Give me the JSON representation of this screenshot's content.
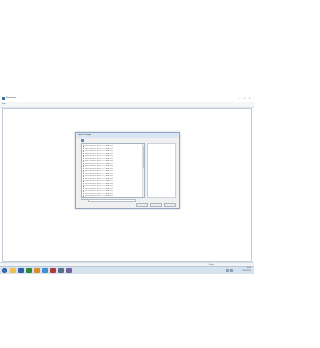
{
  "app": {
    "title": "Mongoose",
    "window_controls": [
      "–",
      "□",
      "×"
    ],
    "menu": [
      "File"
    ]
  },
  "dialog": {
    "title": "Open Package",
    "close_glyph": "×",
    "up_icon": "folder-up-icon",
    "files": [
      "0001 UN-2013 Ver13 - 4.7 - Audi VW",
      "0002 UN-2013 Ver13 - 4.7 - Audi VW",
      "0003 UN-2013 Ver13 - 4.7 - Audi VW",
      "0004 UN-2013 Ver13 - 4.7 - Audi VW",
      "0005 UN-2013 Ver13 - 4.7 - Audi VW",
      "0006 UN-2013 Ver13 - 4.7 - Audi VW",
      "0007 UN-2013 Ver13 - 4.7 - Audi VW",
      "0008 UN-2013 Ver13 - 4.7 - Audi VW",
      "0009 UN-2013 Ver13 - 4.7 - Audi VW",
      "0010 UN-2013 Ver13 - 4.7 - Audi VW",
      "0011 UN-2013 Ver13 - 4.7 - Audi VW",
      "0012 UN-2013 Ver13 - 4.7 - Audi VW",
      "0013 UN-2013 Ver13 - 4.7 - Audi VW",
      "0014 UN-2013 Ver13 - 4.7 - Audi VW",
      "0015 UN-2013 Ver13 - 4.7 - Audi VW",
      "0016 UN-2013 Ver13 - 4.7 - Audi VW",
      "0017 UN-2013 Ver13 - 4.7 - Audi VW",
      "0018 UN-2013 Ver13 - 4.7 - Audi VW",
      "0019 UN-2013 Ver13 - 4.7 - Audi VW",
      "0020 UN-2013 Ver13 - 4.7 - Audi VW",
      "0021 UN-2013 Ver13 - 4.7 - Audi VW"
    ],
    "field_label": "Selection:",
    "field_value": "",
    "buttons": [
      "Cancel",
      "Open",
      "Back"
    ]
  },
  "status": {
    "right_text": "Ready"
  },
  "taskbar": {
    "apps": [
      {
        "name": "explorer-icon",
        "color": "#f0c04a"
      },
      {
        "name": "word-icon",
        "color": "#2f5fa8"
      },
      {
        "name": "excel-icon",
        "color": "#2e8b3c"
      },
      {
        "name": "media-player-icon",
        "color": "#e08a2a"
      },
      {
        "name": "browser-icon",
        "color": "#3d8fd6"
      },
      {
        "name": "app-icon",
        "color": "#b03a3a"
      },
      {
        "name": "mongoose-icon",
        "color": "#5b6f8a"
      },
      {
        "name": "tool-icon",
        "color": "#7a5fa0"
      }
    ],
    "time": "10:45",
    "date": "2013/05/14"
  },
  "colors": {
    "accent": "#2f76c8",
    "dialog_border": "#8fa7c4",
    "taskbar": "#d7e2ef"
  }
}
